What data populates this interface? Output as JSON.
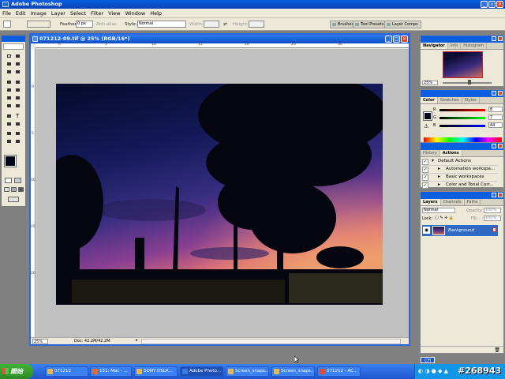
{
  "app": {
    "title": "Adobe Photoshop"
  },
  "menubar": [
    "File",
    "Edit",
    "Image",
    "Layer",
    "Select",
    "Filter",
    "View",
    "Window",
    "Help"
  ],
  "options": {
    "feather_label": "Feather:",
    "feather_value": "0 px",
    "antialias_label": "Anti-alias",
    "style_label": "Style:",
    "style_value": "Normal",
    "width_label": "Width:",
    "height_label": "Height:",
    "workspace_tabs": [
      "Brushes",
      "Tool Presets",
      "Layer Comps"
    ]
  },
  "document": {
    "title": "071212-09.tif @ 25% (RGB/16*)",
    "ruler_top": [
      "0",
      "5",
      "10",
      "15",
      "20",
      "25",
      "30"
    ],
    "ruler_left": [
      "0",
      "5",
      "10",
      "15",
      "20"
    ],
    "zoom": "25%",
    "doc_info": "Doc: 42.2M/42.2M"
  },
  "navigator": {
    "tabs": [
      "Navigator",
      "Info",
      "Histogram"
    ],
    "zoom": "25%"
  },
  "color": {
    "tabs": [
      "Color",
      "Swatches",
      "Styles"
    ],
    "rows": [
      {
        "label": "R",
        "value": "8"
      },
      {
        "label": "G",
        "value": "7"
      },
      {
        "label": "B",
        "value": "44"
      }
    ],
    "foreground": "#050518"
  },
  "actions": {
    "tabs": [
      "History",
      "Actions"
    ],
    "items": [
      "Default Actions",
      "Automation workspa...",
      "Basic workspaces",
      "Color and Tonal Corr..."
    ]
  },
  "layers": {
    "tabs": [
      "Layers",
      "Channels",
      "Paths"
    ],
    "blend_mode": "Normal",
    "opacity_label": "Opacity:",
    "opacity_value": "100%",
    "lock_label": "Lock:",
    "fill_label": "Fill:",
    "fill_value": "100%",
    "items": [
      {
        "name": "Background",
        "visible": true,
        "locked": true
      }
    ]
  },
  "taskbar": {
    "start_label": "開始",
    "buttons": [
      "071212",
      "151: Mac - ...",
      "SONY DSLR...",
      "Adobe Photo...",
      "Screen_snaps...",
      "Screen_snaps...",
      "071212 - AC..."
    ],
    "active_index": 3,
    "language_indicator": "CH"
  },
  "watermark": "#268943"
}
